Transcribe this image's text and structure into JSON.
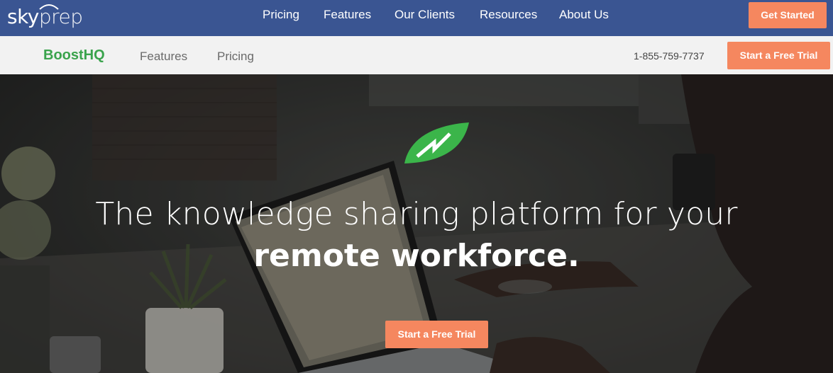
{
  "topnav": {
    "logo": {
      "prefix": "sky",
      "suffix": "prep"
    },
    "links": [
      "Pricing",
      "Features",
      "Our Clients",
      "Resources",
      "About Us"
    ],
    "cta_label": "Get Started",
    "background": "#3a5592"
  },
  "subnav": {
    "brand": "BoostHQ",
    "links": [
      "Features",
      "Pricing"
    ],
    "phone": "1-855-759-7737",
    "cta_label": "Start a Free Trial",
    "brand_color": "#3aa34c"
  },
  "hero": {
    "headline_line1": "The knowledge sharing platform for your",
    "headline_line2": "remote workforce.",
    "cta_label": "Start a Free Trial",
    "icon": "leaf-bolt-icon"
  },
  "colors": {
    "accent": "#f5875f",
    "leaf": "#3bb54a"
  }
}
